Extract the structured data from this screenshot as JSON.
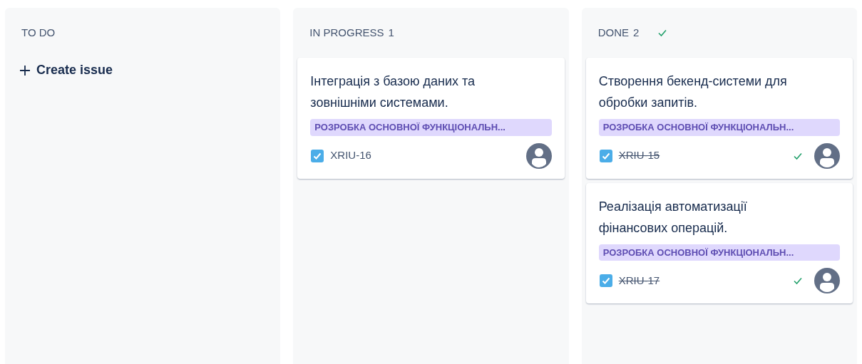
{
  "columns": [
    {
      "title": "TO DO",
      "create_label": "Create issue"
    },
    {
      "title": "IN PROGRESS",
      "count": "1",
      "complete": false,
      "cards": [
        {
          "summary": "Інтеграція з базою даних та зовнішніми системами.",
          "epic": "РОЗРОБКА ОСНОВНОЇ ФУНКЦІОНАЛЬН...",
          "key": "XRIU-16",
          "done": false
        }
      ]
    },
    {
      "title": "DONE",
      "count": "2",
      "complete": true,
      "cards": [
        {
          "summary": "Створення бекенд-системи для обробки запитів.",
          "epic": "РОЗРОБКА ОСНОВНОЇ ФУНКЦІОНАЛЬН...",
          "key": "XRIU-15",
          "done": true
        },
        {
          "summary": "Реалізація автоматизації фінансових операцій.",
          "epic": "РОЗРОБКА ОСНОВНОЇ ФУНКЦІОНАЛЬН...",
          "key": "XRIU-17",
          "done": true
        }
      ]
    }
  ]
}
